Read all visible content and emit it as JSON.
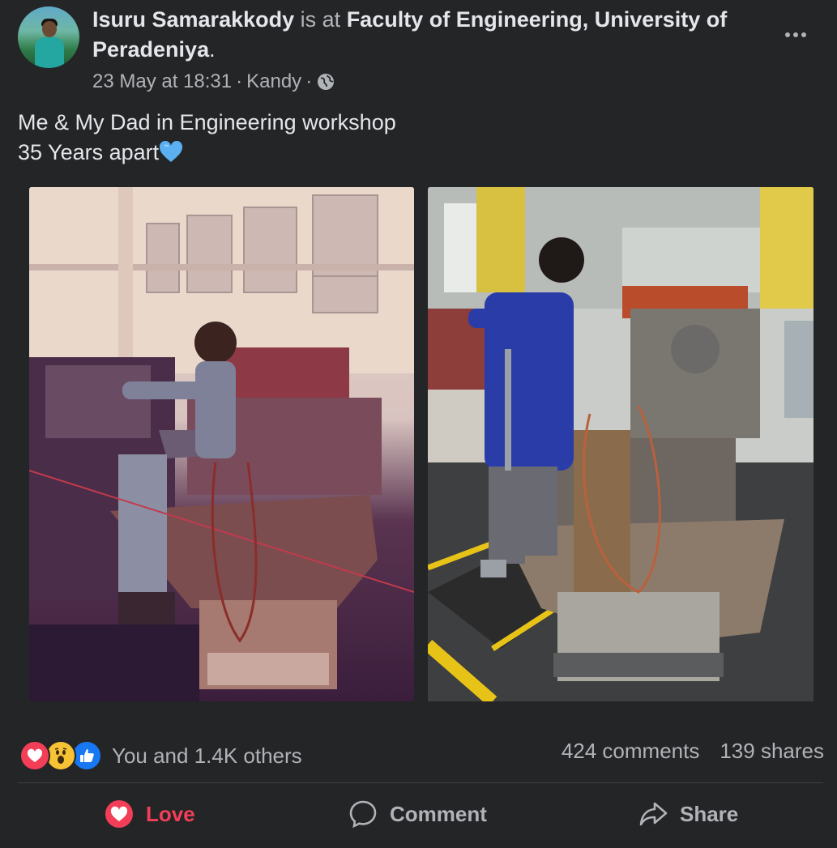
{
  "post": {
    "author": "Isuru Samarakkody",
    "connector": "is at",
    "place": "Faculty of Engineering, University of Peradeniya",
    "place_end": ".",
    "timestamp": "23 May at 18:31",
    "separator": "·",
    "location": "Kandy",
    "audience_icon": "globe-icon",
    "more_icon": "more-options-icon",
    "caption_line_1": "Me & My Dad in Engineering workshop",
    "caption_line_2": "35 Years apart",
    "caption_emoji": "blue-heart-icon"
  },
  "reactions": {
    "icons": [
      "love-reaction-icon",
      "wow-reaction-icon",
      "like-reaction-icon"
    ],
    "summary": "You and 1.4K others",
    "comments": "424 comments",
    "shares": "139 shares"
  },
  "actions": {
    "love": "Love",
    "comment": "Comment",
    "share": "Share"
  },
  "colors": {
    "background": "#242526",
    "text_primary": "#e4e6eb",
    "text_secondary": "#b0b3b8",
    "love": "#f33e58",
    "like": "#1877f2",
    "wow": "#f7c234",
    "blue_heart": "#5ab0f0"
  }
}
